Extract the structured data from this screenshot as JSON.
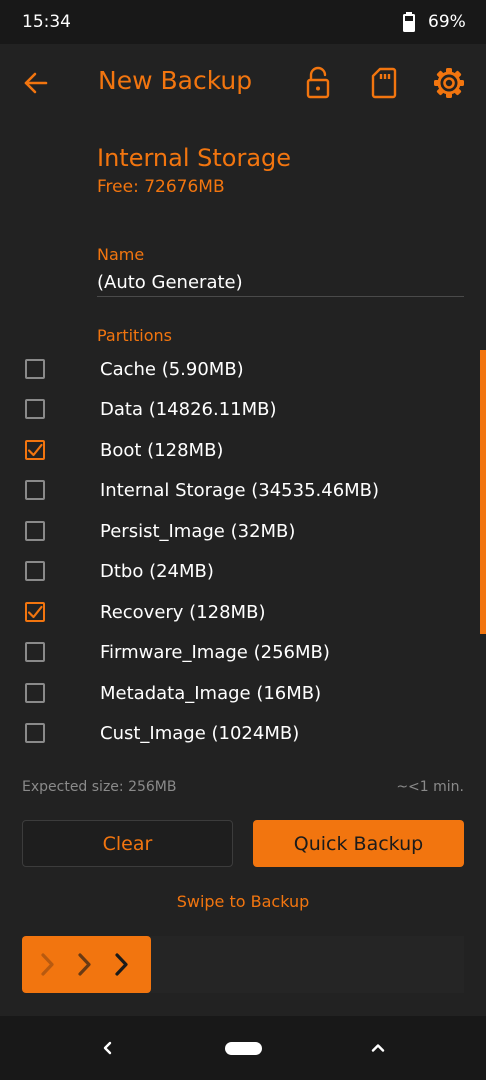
{
  "status": {
    "time": "15:34",
    "battery_percent": "69%"
  },
  "header": {
    "title": "New Backup",
    "icons": [
      "back-arrow-icon",
      "lock-open-icon",
      "sd-card-icon",
      "gear-icon"
    ]
  },
  "storage": {
    "name": "Internal Storage",
    "free": "Free: 72676MB"
  },
  "name_field": {
    "label": "Name",
    "value": "(Auto Generate)"
  },
  "partitions": {
    "label": "Partitions",
    "items": [
      {
        "label": "Cache (5.90MB)",
        "checked": false
      },
      {
        "label": "Data (14826.11MB)",
        "checked": false
      },
      {
        "label": "Boot (128MB)",
        "checked": true
      },
      {
        "label": "Internal Storage (34535.46MB)",
        "checked": false
      },
      {
        "label": "Persist_Image (32MB)",
        "checked": false
      },
      {
        "label": "Dtbo (24MB)",
        "checked": false
      },
      {
        "label": "Recovery (128MB)",
        "checked": true
      },
      {
        "label": "Firmware_Image (256MB)",
        "checked": false
      },
      {
        "label": "Metadata_Image (16MB)",
        "checked": false
      },
      {
        "label": "Cust_Image (1024MB)",
        "checked": false
      }
    ]
  },
  "summary": {
    "expected": "Expected size:  256MB",
    "time": "~<1 min."
  },
  "buttons": {
    "clear": "Clear",
    "quick_backup": "Quick Backup"
  },
  "swipe": {
    "label": "Swipe to Backup"
  },
  "colors": {
    "accent": "#f2750f",
    "background": "#222222",
    "bars": "#181818"
  }
}
